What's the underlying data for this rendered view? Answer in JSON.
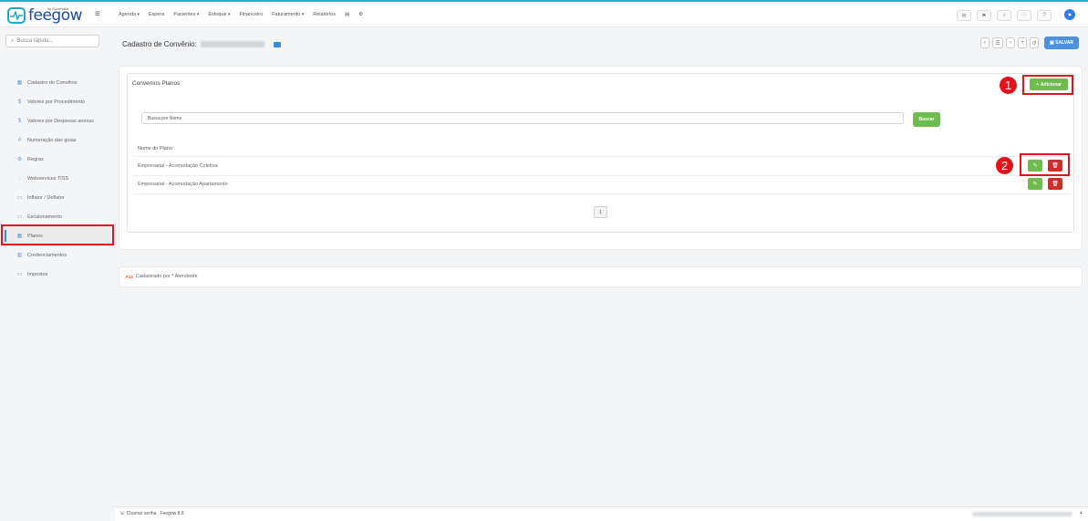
{
  "app": {
    "logo_text": "feegow",
    "logo_tag": "by Doctoralia"
  },
  "topnav": [
    "Agenda",
    "Espera",
    "Pacientes",
    "Estoque",
    "Financeiro",
    "Faturamento",
    "Relatórios"
  ],
  "topnav_caret": [
    true,
    false,
    true,
    true,
    false,
    true,
    false
  ],
  "top_icons": [
    "mail-icon",
    "flag-icon",
    "bell-icon",
    "chat-icon",
    "help-icon"
  ],
  "search": {
    "placeholder": "Busca rápida..."
  },
  "page": {
    "title": "Cadastro de Convênio:"
  },
  "toolbar": {
    "save_label": "SALVAR"
  },
  "sidebar": {
    "items": [
      {
        "label": "Cadastro do Convênio",
        "icon": "▦"
      },
      {
        "label": "Valores por Procedimento",
        "icon": "$"
      },
      {
        "label": "Valores por Despesas anexas",
        "icon": "$"
      },
      {
        "label": "Numeração das guias",
        "icon": "#"
      },
      {
        "label": "Regras",
        "icon": "⚙"
      },
      {
        "label": "Webservices TISS",
        "icon": "◌"
      },
      {
        "label": "Inflator / Deflator",
        "icon": "▭"
      },
      {
        "label": "Escalonamento",
        "icon": "▭"
      },
      {
        "label": "Planos",
        "icon": "▦"
      },
      {
        "label": "Credenciamentos",
        "icon": "▥"
      },
      {
        "label": "Impostos",
        "icon": "▭"
      }
    ]
  },
  "planos": {
    "title": "Convenios Planos",
    "add_label": "Adicionar",
    "search_placeholder": "Busca por Nome",
    "search_button": "Buscar",
    "column_header": "Nome do Plano",
    "rows": [
      "Empresarial - Acomodação Coletiva",
      "Empresarial - Acomodação Apartamento"
    ],
    "page": "1"
  },
  "annotations": [
    "1",
    "2"
  ],
  "footer": {
    "badge": "F14",
    "text": "Cadastrado por * Atendente"
  },
  "bottom": {
    "chamar_senha": "Chamar senha",
    "version": "Feegow 8.9"
  },
  "colors": {
    "accent": "#3a8cdc",
    "success": "#6fbc4e",
    "danger": "#c9302c",
    "highlight": "#e0141c"
  }
}
